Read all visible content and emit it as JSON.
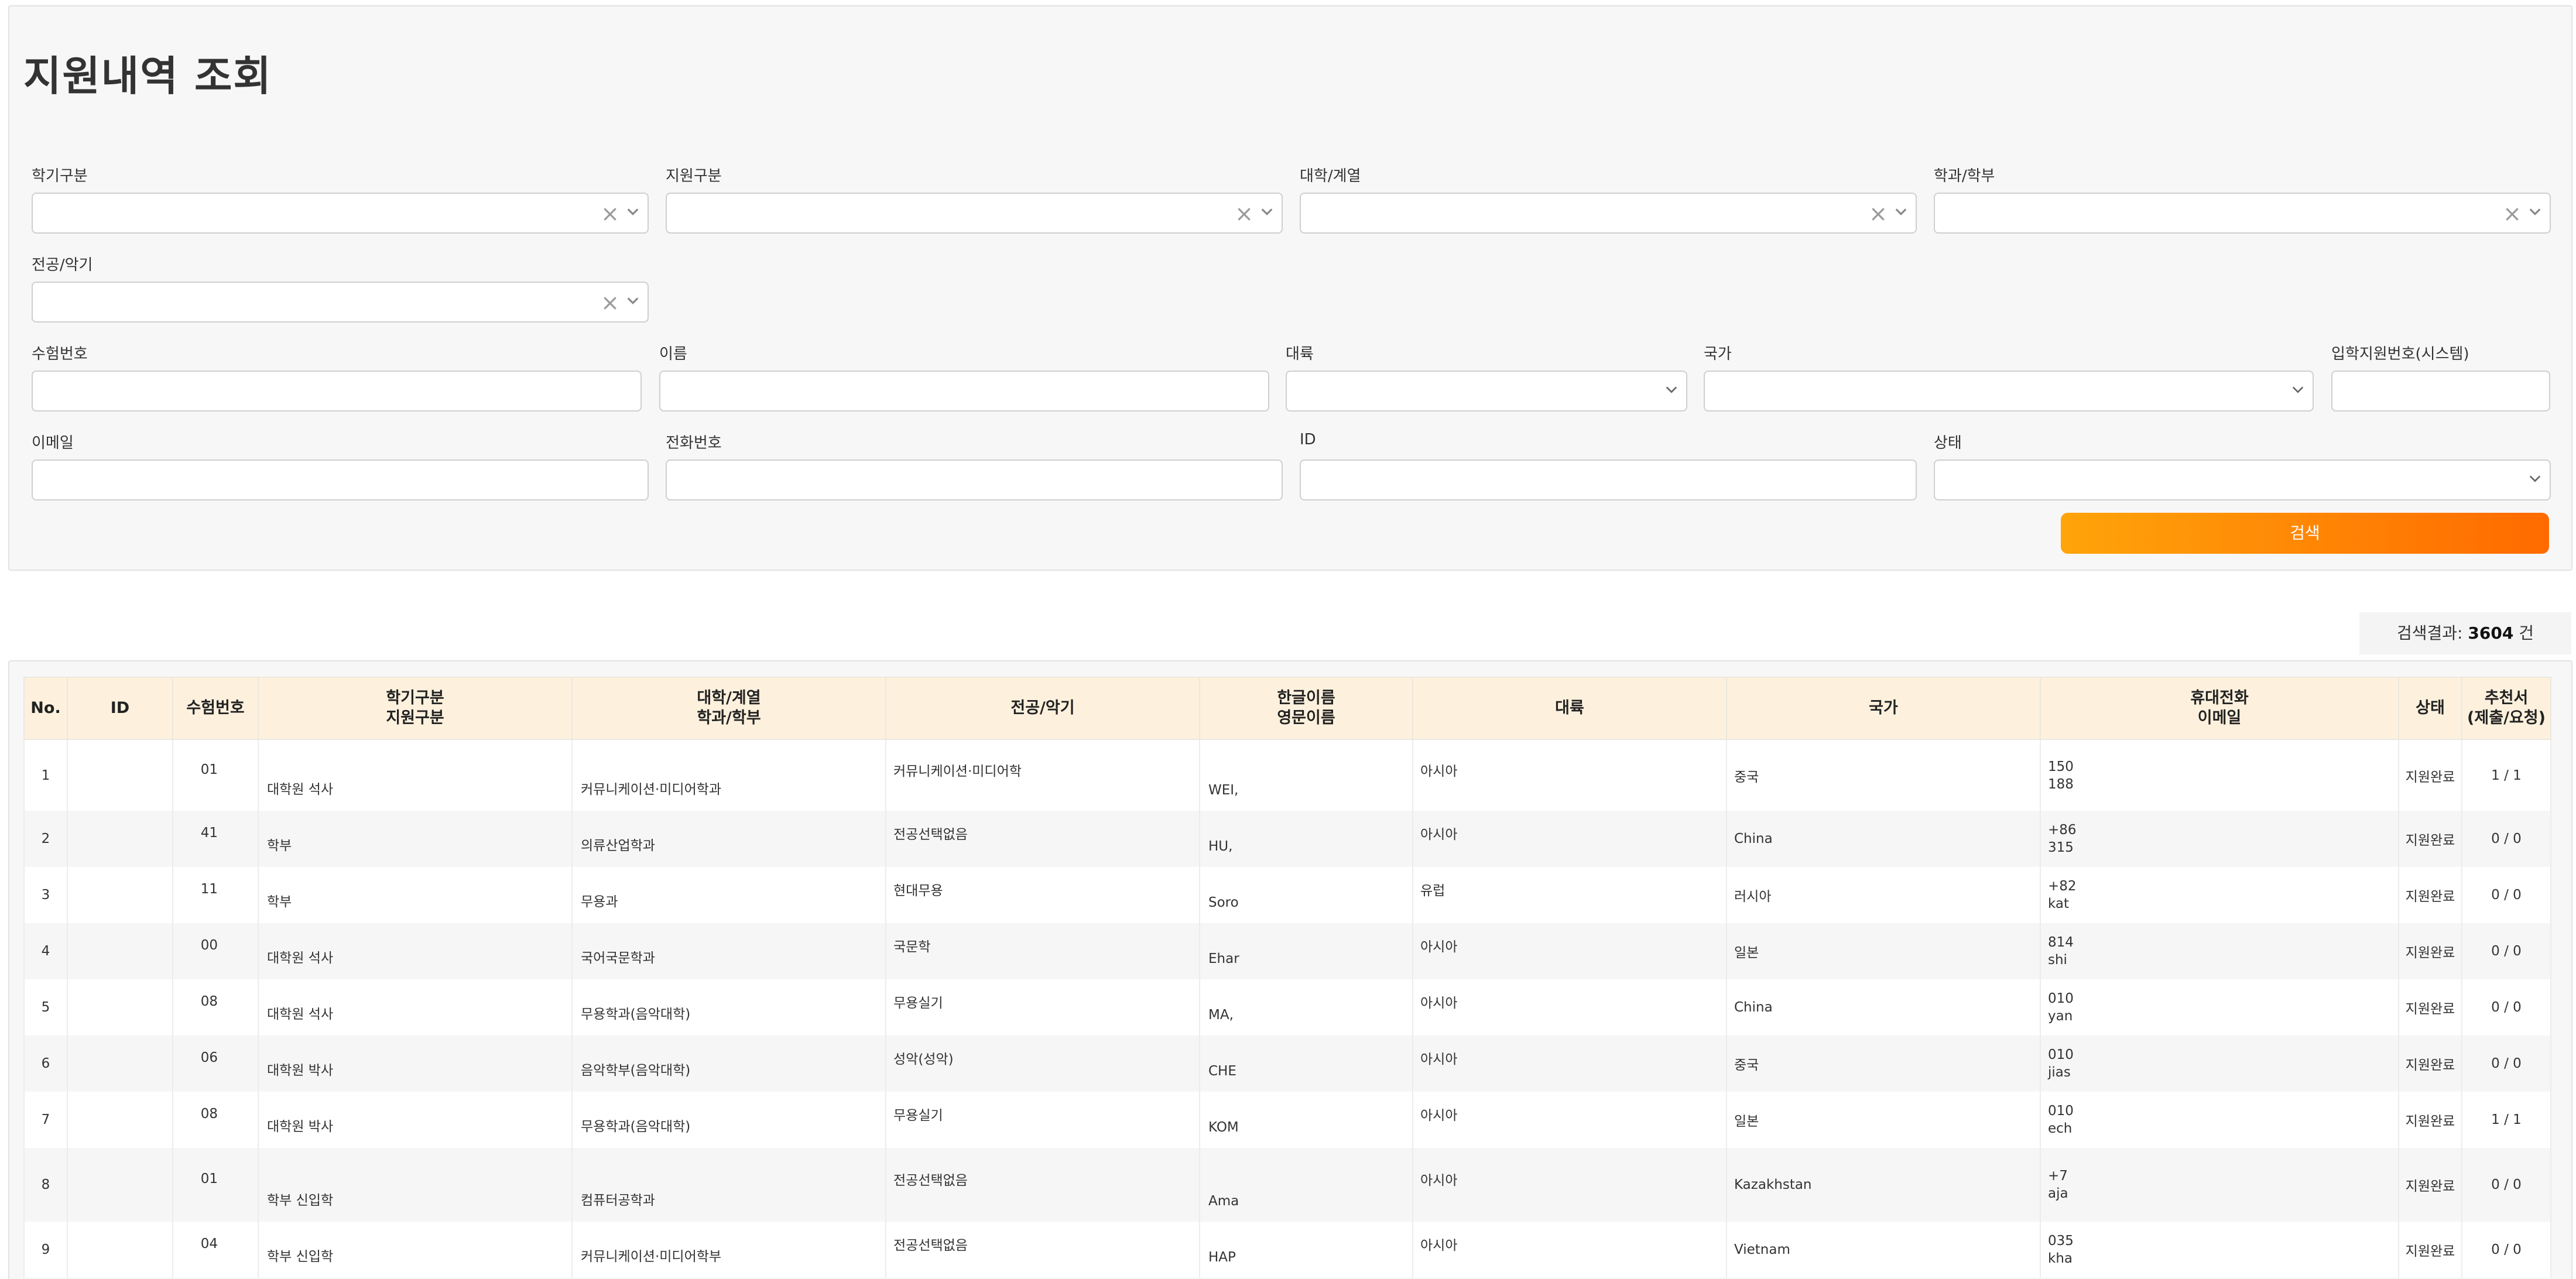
{
  "page": {
    "title": "지원내역 조회"
  },
  "filters": {
    "semester": {
      "label": "학기구분"
    },
    "apply_type": {
      "label": "지원구분"
    },
    "college": {
      "label": "대학/계열"
    },
    "department": {
      "label": "학과/학부"
    },
    "major": {
      "label": "전공/악기"
    },
    "exam_no": {
      "label": "수험번호",
      "value": ""
    },
    "name": {
      "label": "이름",
      "value": ""
    },
    "continent": {
      "label": "대륙",
      "value": ""
    },
    "country": {
      "label": "국가",
      "value": ""
    },
    "system_no": {
      "label": "입학지원번호(시스템)",
      "value": ""
    },
    "email": {
      "label": "이메일",
      "value": ""
    },
    "phone": {
      "label": "전화번호",
      "value": ""
    },
    "id": {
      "label": "ID",
      "value": ""
    },
    "status": {
      "label": "상태",
      "value": ""
    },
    "clear_glyph": "×",
    "search_label": "검색"
  },
  "results": {
    "prefix": "검색결과:",
    "count": "3604",
    "unit": "건"
  },
  "table": {
    "headers": [
      "No.",
      "ID",
      "수험번호",
      "학기구분\n지원구분",
      "대학/계열\n학과/학부",
      "전공/악기",
      "한글이름\n영문이름",
      "대륙",
      "국가",
      "휴대전화\n이메일",
      "상태",
      "추천서\n(제출/요청)"
    ],
    "rows": [
      {
        "no": "1",
        "id": "",
        "exam": "01",
        "type": "대학원 석사",
        "dept": "커뮤니케이션·미디어학과",
        "major": "커뮤니케이션·미디어학",
        "name": "WEI,",
        "continent": "아시아",
        "country": "중국",
        "contact": "150\n188",
        "status": "지원완료",
        "rec": "1 / 1"
      },
      {
        "no": "2",
        "id": "",
        "exam": "41",
        "type": "학부",
        "dept": "의류산업학과",
        "major": "전공선택없음",
        "name": "HU,",
        "continent": "아시아",
        "country": "China",
        "contact": "+86\n315",
        "status": "지원완료",
        "rec": "0 / 0"
      },
      {
        "no": "3",
        "id": "",
        "exam": "11",
        "type": "학부",
        "dept": "무용과",
        "major": "현대무용",
        "name": "Soro",
        "continent": "유럽",
        "country": "러시아",
        "contact": "+82\nkat",
        "status": "지원완료",
        "rec": "0 / 0"
      },
      {
        "no": "4",
        "id": "",
        "exam": "00",
        "type": "대학원 석사",
        "dept": "국어국문학과",
        "major": "국문학",
        "name": "Ehar",
        "continent": "아시아",
        "country": "일본",
        "contact": "814\nshi",
        "status": "지원완료",
        "rec": "0 / 0"
      },
      {
        "no": "5",
        "id": "",
        "exam": "08",
        "type": "대학원 석사",
        "dept": "무용학과(음악대학)",
        "major": "무용실기",
        "name": "MA,",
        "continent": "아시아",
        "country": "China",
        "contact": "010\nyan",
        "status": "지원완료",
        "rec": "0 / 0"
      },
      {
        "no": "6",
        "id": "",
        "exam": "06",
        "type": "대학원 박사",
        "dept": "음악학부(음악대학)",
        "major": "성악(성악)",
        "name": "CHE",
        "continent": "아시아",
        "country": "중국",
        "contact": "010\njias",
        "status": "지원완료",
        "rec": "0 / 0"
      },
      {
        "no": "7",
        "id": "",
        "exam": "08",
        "type": "대학원 박사",
        "dept": "무용학과(음악대학)",
        "major": "무용실기",
        "name": "KOM",
        "continent": "아시아",
        "country": "일본",
        "contact": "010\nech",
        "status": "지원완료",
        "rec": "1 / 1"
      },
      {
        "no": "8",
        "id": "",
        "exam": "01",
        "type": "학부 신입학",
        "dept": "컴퓨터공학과",
        "major": "전공선택없음",
        "name": "Ama",
        "continent": "아시아",
        "country": "Kazakhstan",
        "contact": "+7\naja",
        "status": "지원완료",
        "rec": "0 / 0"
      },
      {
        "no": "9",
        "id": "",
        "exam": "04",
        "type": "학부 신입학",
        "dept": "커뮤니케이션·미디어학부",
        "major": "전공선택없음",
        "name": "HAP",
        "continent": "아시아",
        "country": "Vietnam",
        "contact": "035\nkha",
        "status": "지원완료",
        "rec": "0 / 0"
      }
    ]
  },
  "icons": {
    "clear": "clear-x-icon",
    "dropdown": "chevron-down-icon"
  }
}
